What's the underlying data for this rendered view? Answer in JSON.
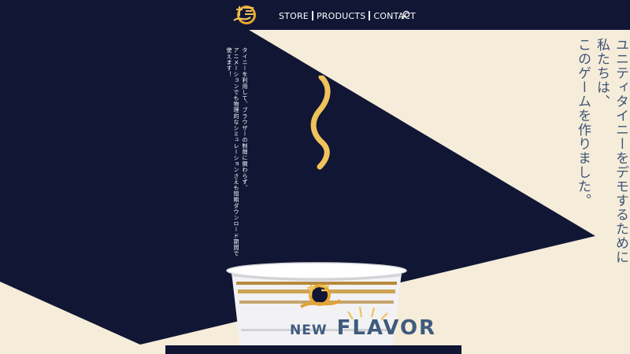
{
  "nav": {
    "items": [
      {
        "label": "STORE"
      },
      {
        "label": "PRODUCTS"
      },
      {
        "label": "CONTACT"
      }
    ],
    "search_icon": "search-icon",
    "logo_icon": "noodle-logo-icon"
  },
  "hero": {
    "small_text": [
      "タイニーを利用して、ブラウザーの制限に関わらず、",
      "アニメーションでも物理的なシミュレーションさえも短期ダウンロード期間で使えます！"
    ],
    "big_text": [
      "ユニティタイニーをデモするために私たちは、",
      "このゲームを作りました。"
    ]
  },
  "flavor": {
    "new_label": "NEW",
    "flavor_label": "FLAVOR"
  },
  "colors": {
    "navy": "#101634",
    "cream": "#f5ecda",
    "accent_blue": "#3f5b7e",
    "noodle_yellow": "#f0c35a"
  }
}
